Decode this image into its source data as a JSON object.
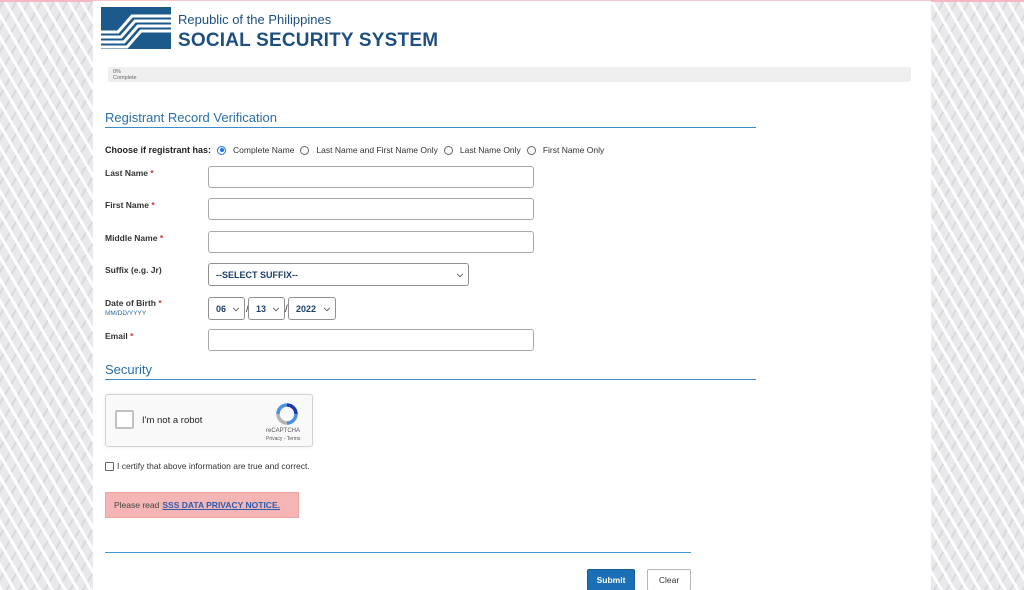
{
  "header": {
    "republic": "Republic of the Philippines",
    "agency": "SOCIAL SECURITY SYSTEM"
  },
  "progress": {
    "percent_text": "0%",
    "complete_text": "Complete",
    "value": 0
  },
  "sections": {
    "verification_title": "Registrant Record Verification",
    "security_title": "Security"
  },
  "registrant_choice": {
    "label": "Choose if registrant has:",
    "options": [
      {
        "label": "Complete Name",
        "selected": true
      },
      {
        "label": "Last Name and First Name Only",
        "selected": false
      },
      {
        "label": "Last Name Only",
        "selected": false
      },
      {
        "label": "First Name Only",
        "selected": false
      }
    ]
  },
  "fields": {
    "last_name": {
      "label": "Last Name",
      "required": "*",
      "value": ""
    },
    "first_name": {
      "label": "First Name",
      "required": "*",
      "value": ""
    },
    "middle_name": {
      "label": "Middle Name",
      "required": "*",
      "value": ""
    },
    "suffix": {
      "label": "Suffix (e.g. Jr)",
      "selected": "--SELECT SUFFIX--"
    },
    "dob": {
      "label": "Date of Birth",
      "required": "*",
      "format_hint": "MM/DD/YYYY",
      "month": "06",
      "day": "13",
      "year": "2022",
      "separator": "/"
    },
    "email": {
      "label": "Email",
      "required": "*",
      "value": ""
    }
  },
  "captcha": {
    "text": "I'm not a robot",
    "brand": "reCAPTCHA",
    "links": "Privacy - Terms"
  },
  "certify": {
    "text": "I certify that above information are true and correct.",
    "checked": false
  },
  "notice": {
    "prefix": "Please read",
    "link": "SSS DATA PRIVACY NOTICE."
  },
  "buttons": {
    "submit": "Submit",
    "clear": "Clear"
  },
  "colors": {
    "brand_blue": "#1e4f80",
    "accent_blue": "#2a6fa8",
    "submit_blue": "#1b6fb5",
    "notice_pink": "#f5b5b5",
    "required_red": "#d62c2c"
  }
}
